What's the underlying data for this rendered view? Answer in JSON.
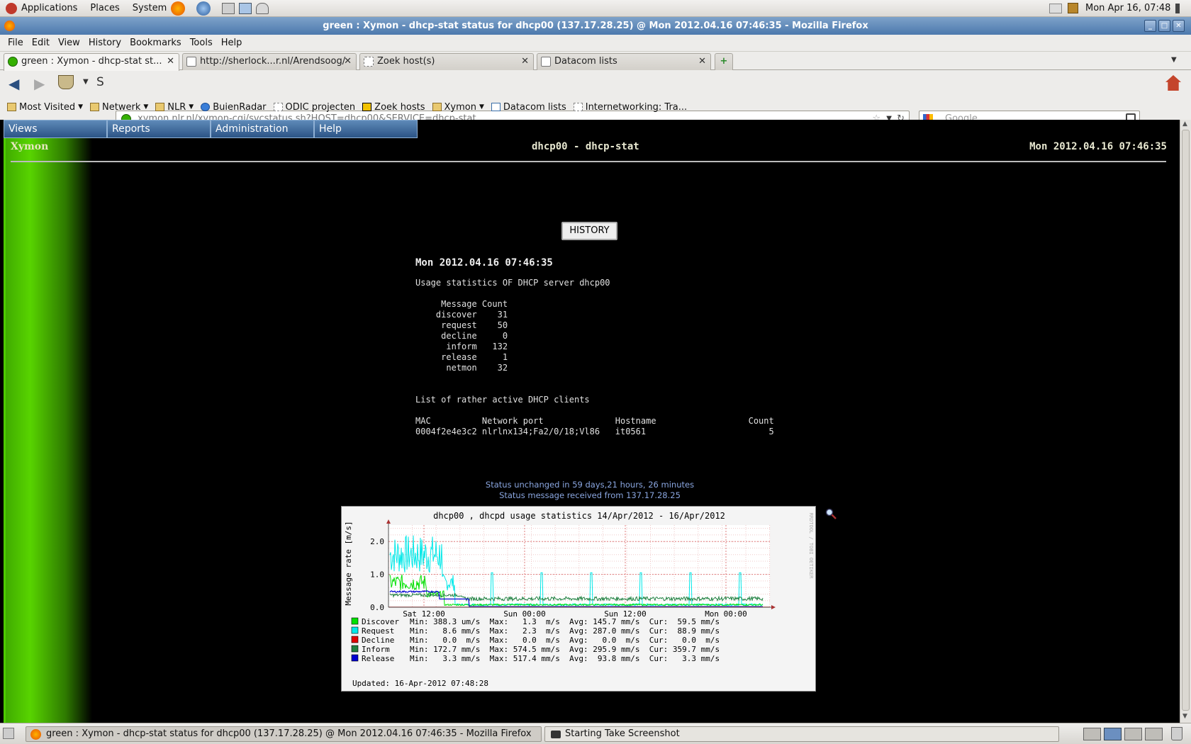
{
  "panel": {
    "menus": [
      "Applications",
      "Places",
      "System"
    ],
    "clock": "Mon Apr 16, 07:48"
  },
  "window": {
    "title": "green : Xymon - dhcp-stat status for dhcp00 (137.17.28.25) @ Mon 2012.04.16 07:46:35 - Mozilla Firefox"
  },
  "menubar": [
    "File",
    "Edit",
    "View",
    "History",
    "Bookmarks",
    "Tools",
    "Help"
  ],
  "tabs": [
    {
      "label": "green : Xymon - dhcp-stat st...",
      "active": true
    },
    {
      "label": "http://sherlock...r.nl/Arendsoog/",
      "active": false
    },
    {
      "label": "Zoek host(s)",
      "active": false
    },
    {
      "label": "Datacom lists",
      "active": false
    }
  ],
  "url": {
    "value": "xymon.nlr.nl/xymon-cgi/svcstatus.sh?HOST=dhcp00&SERVICE=dhcp-stat",
    "search_placeholder": "Google"
  },
  "bookmarks": [
    "Most Visited",
    "Netwerk",
    "NLR",
    "BuienRadar",
    "ODIC projecten",
    "Zoek hosts",
    "Xymon",
    "Datacom lists",
    "Internetworking: Tra..."
  ],
  "xymon": {
    "menu": [
      "Views",
      "Reports",
      "Administration",
      "Help"
    ],
    "brand": "Xymon",
    "header_title": "dhcp00 - dhcp-stat",
    "header_time": "Mon 2012.04.16 07:46:35",
    "history_button": "HISTORY",
    "report_time": "Mon 2012.04.16 07:46:35",
    "report_body": "Usage statistics OF DHCP server dhcp00\n\n     Message Count\n    discover    31\n     request    50\n     decline     0\n      inform   132\n     release     1\n      netmon    32\n\n\nList of rather active DHCP clients\n\nMAC          Network port              Hostname                  Count\n0004f2e4e3c2 nlrlnx134;Fa2/0/18;Vl86   it0561                        5",
    "status_line1": "Status unchanged in 59 days,21 hours, 26 minutes",
    "status_line2": "Status message received from 137.17.28.25"
  },
  "chart_data": {
    "type": "line",
    "title": "dhcp00 , dhcpd usage statistics 14/Apr/2012 - 16/Apr/2012",
    "ylabel": "Message rate [m/s]",
    "xlabel": "",
    "x_ticks": [
      "Sat 12:00",
      "Sun 00:00",
      "Sun 12:00",
      "Mon 00:00"
    ],
    "y_ticks": [
      "0.0",
      "1.0",
      "2.0"
    ],
    "ylim": [
      0,
      2.5
    ],
    "watermark": "RRDTOOL / TOBI OETIKER",
    "series": [
      {
        "name": "Discover",
        "color": "#00e000",
        "stats": "Min: 388.3 um/s  Max:   1.3  m/s  Avg: 145.7 mm/s  Cur:  59.5 mm/s"
      },
      {
        "name": "Request",
        "color": "#00e8e8",
        "stats": "Min:   8.6 mm/s  Max:   2.3  m/s  Avg: 287.0 mm/s  Cur:  88.9 mm/s"
      },
      {
        "name": "Decline",
        "color": "#e00000",
        "stats": "Min:   0.0  m/s  Max:   0.0  m/s  Avg:   0.0  m/s  Cur:   0.0  m/s"
      },
      {
        "name": "Inform",
        "color": "#208040",
        "stats": "Min: 172.7 mm/s  Max: 574.5 mm/s  Avg: 295.9 mm/s  Cur: 359.7 mm/s"
      },
      {
        "name": "Release",
        "color": "#0000d0",
        "stats": "Min:   3.3 mm/s  Max: 517.4 mm/s  Avg:  93.8 mm/s  Cur:   3.3 mm/s"
      }
    ],
    "updated": "Updated: 16-Apr-2012 07:48:28"
  },
  "taskbar": {
    "items": [
      "green : Xymon - dhcp-stat status for dhcp00 (137.17.28.25) @ Mon 2012.04.16 07:46:35 - Mozilla Firefox",
      "Starting Take Screenshot"
    ]
  }
}
